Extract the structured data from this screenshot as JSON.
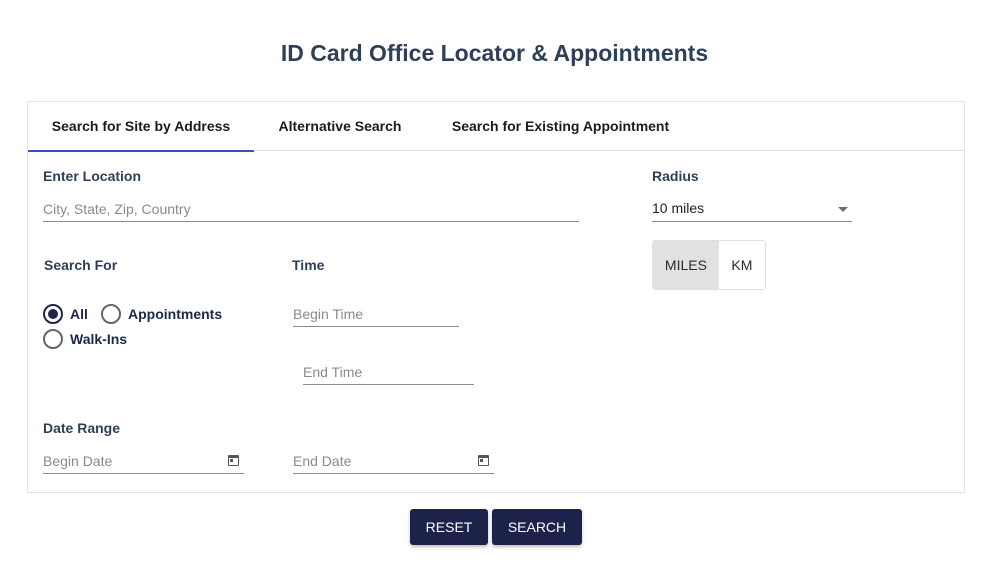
{
  "page": {
    "title": "ID Card Office Locator & Appointments"
  },
  "tabs": [
    {
      "label": "Search for Site by Address",
      "active": true
    },
    {
      "label": "Alternative Search",
      "active": false
    },
    {
      "label": "Search for Existing Appointment",
      "active": false
    }
  ],
  "location": {
    "label": "Enter Location",
    "placeholder": "City, State, Zip, Country",
    "value": ""
  },
  "radius": {
    "label": "Radius",
    "selected": "10 miles",
    "units": [
      {
        "label": "MILES",
        "selected": true
      },
      {
        "label": "KM",
        "selected": false
      }
    ]
  },
  "search_for": {
    "label": "Search For",
    "options": [
      {
        "label": "All",
        "checked": true
      },
      {
        "label": "Appointments",
        "checked": false
      },
      {
        "label": "Walk-Ins",
        "checked": false
      }
    ]
  },
  "time": {
    "label": "Time",
    "begin_placeholder": "Begin Time",
    "end_placeholder": "End Time"
  },
  "date_range": {
    "label": "Date Range",
    "begin_placeholder": "Begin Date",
    "end_placeholder": "End Date"
  },
  "actions": {
    "reset_label": "RESET",
    "search_label": "SEARCH"
  },
  "colors": {
    "accent": "#3f51b5",
    "button": "#1c2249",
    "title": "#2e3f58"
  }
}
